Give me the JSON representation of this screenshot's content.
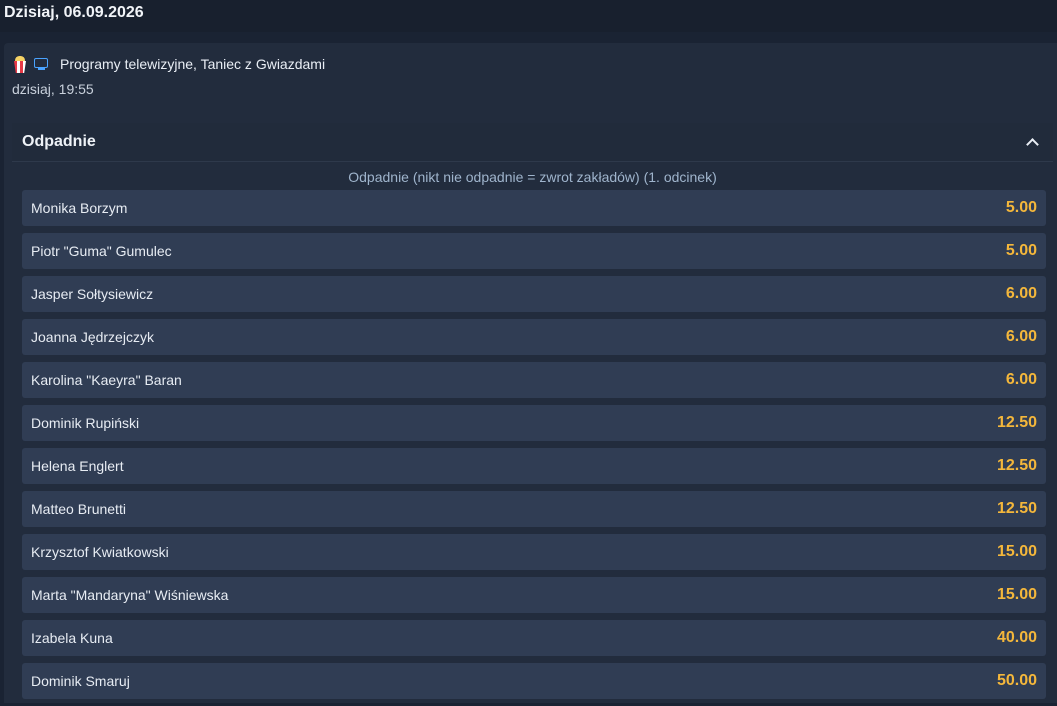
{
  "date_header": "Dzisiaj, 06.09.2026",
  "event": {
    "icons": [
      "popcorn-icon",
      "tv-icon"
    ],
    "title": "Programy telewizyjne, Taniec z Gwiazdami",
    "time": "dzisiaj, 19:55"
  },
  "market": {
    "name": "Odpadnie",
    "subtitle": "Odpadnie (nikt nie odpadnie = zwrot zakładów) (1. odcinek)",
    "selections": [
      {
        "name": "Monika Borzym",
        "odd": "5.00"
      },
      {
        "name": "Piotr \"Guma\" Gumulec",
        "odd": "5.00"
      },
      {
        "name": "Jasper Sołtysiewicz",
        "odd": "6.00"
      },
      {
        "name": "Joanna Jędrzejczyk",
        "odd": "6.00"
      },
      {
        "name": "Karolina \"Kaeyra\" Baran",
        "odd": "6.00"
      },
      {
        "name": "Dominik Rupiński",
        "odd": "12.50"
      },
      {
        "name": "Helena Englert",
        "odd": "12.50"
      },
      {
        "name": "Matteo Brunetti",
        "odd": "12.50"
      },
      {
        "name": "Krzysztof Kwiatkowski",
        "odd": "15.00"
      },
      {
        "name": "Marta \"Mandaryna\" Wiśniewska",
        "odd": "15.00"
      },
      {
        "name": "Izabela Kuna",
        "odd": "40.00"
      },
      {
        "name": "Dominik Smaruj",
        "odd": "50.00"
      }
    ]
  },
  "colors": {
    "odd_accent": "#f4b73b",
    "row_bg": "#303d54",
    "tv_icon": "#4aa3ff"
  }
}
